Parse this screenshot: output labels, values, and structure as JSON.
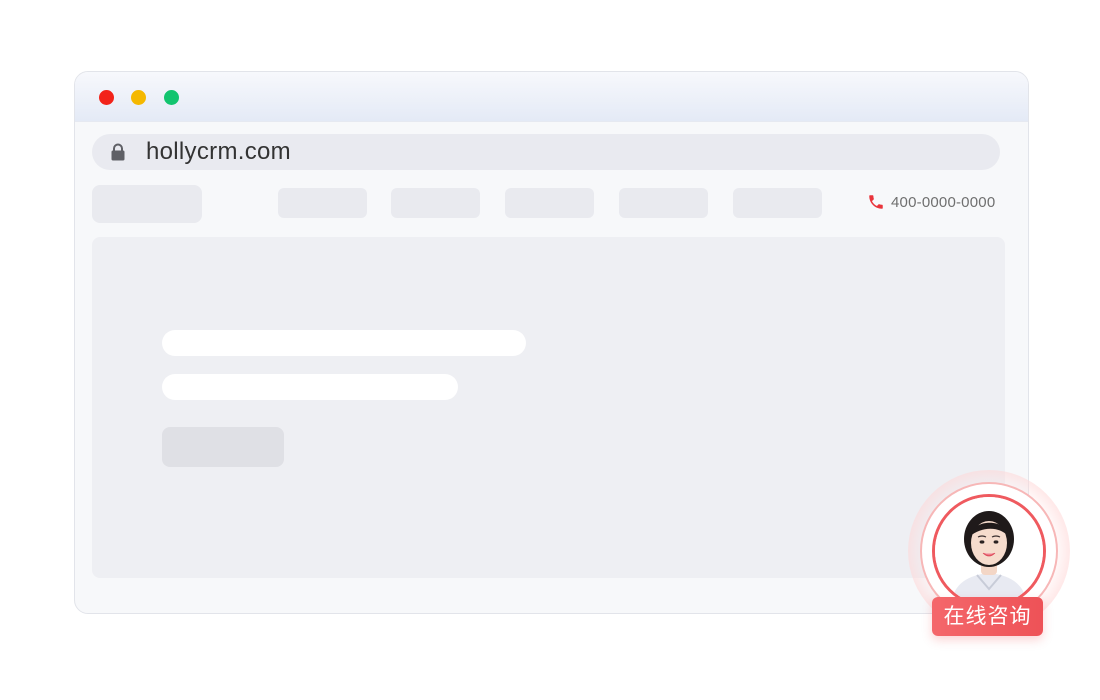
{
  "browser": {
    "traffic_lights": {
      "close_color": "#f2231a",
      "minimize_color": "#f5b800",
      "maximize_color": "#12c46f"
    },
    "address_bar": {
      "url": "hollycrm.com",
      "lock_icon": "lock-icon"
    }
  },
  "nav": {
    "phone_icon": "phone-icon",
    "phone_color": "#e9343b",
    "phone_number": "400-0000-0000"
  },
  "consult": {
    "label": "在线咨询",
    "accent_color": "#ee5257",
    "avatar": "agent-avatar"
  }
}
